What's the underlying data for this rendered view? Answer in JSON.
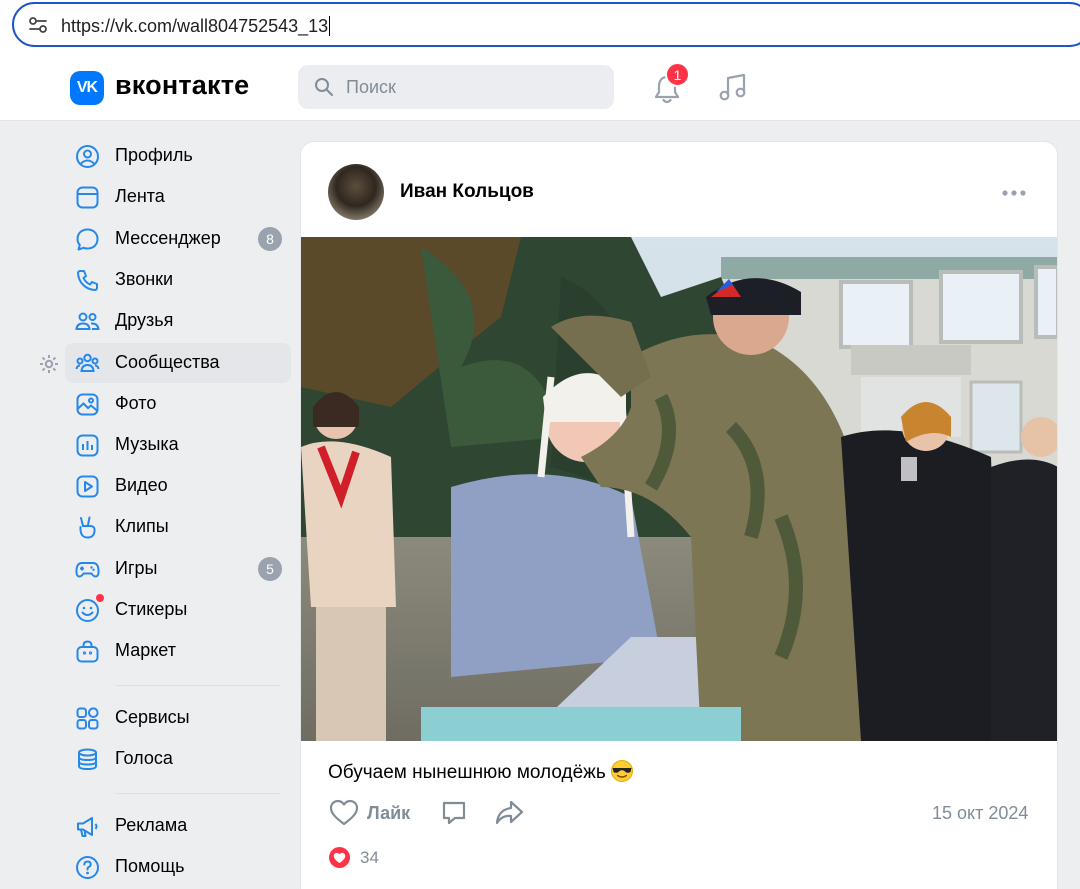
{
  "browser": {
    "url": "https://vk.com/wall804752543_13"
  },
  "header": {
    "logo_text": "VK",
    "brand": "вконтакте",
    "search_placeholder": "Поиск",
    "notification_count": "1"
  },
  "sidebar": {
    "items": [
      {
        "label": "Профиль",
        "icon": "profile-icon"
      },
      {
        "label": "Лента",
        "icon": "feed-icon"
      },
      {
        "label": "Мессенджер",
        "icon": "messenger-icon",
        "count": "8"
      },
      {
        "label": "Звонки",
        "icon": "phone-icon"
      },
      {
        "label": "Друзья",
        "icon": "friends-icon"
      },
      {
        "label": "Сообщества",
        "icon": "communities-icon",
        "active": true
      },
      {
        "label": "Фото",
        "icon": "photo-icon"
      },
      {
        "label": "Музыка",
        "icon": "music-icon"
      },
      {
        "label": "Видео",
        "icon": "video-icon"
      },
      {
        "label": "Клипы",
        "icon": "clips-icon"
      },
      {
        "label": "Игры",
        "icon": "games-icon",
        "count": "5"
      },
      {
        "label": "Стикеры",
        "icon": "stickers-icon"
      },
      {
        "label": "Маркет",
        "icon": "market-icon"
      },
      {
        "label": "Сервисы",
        "icon": "services-icon"
      },
      {
        "label": "Голоса",
        "icon": "votes-icon"
      },
      {
        "label": "Реклама",
        "icon": "ads-icon"
      },
      {
        "label": "Помощь",
        "icon": "help-icon"
      }
    ]
  },
  "post": {
    "author": "Иван Кольцов",
    "text": "Обучаем нынешнюю молодёжь",
    "like_label": "Лайк",
    "date": "15 окт 2024",
    "likes_count": "34"
  },
  "colors": {
    "accent": "#0077ff",
    "badge_red": "#ff3347",
    "muted": "#818c99",
    "page_bg": "#edeef0"
  }
}
